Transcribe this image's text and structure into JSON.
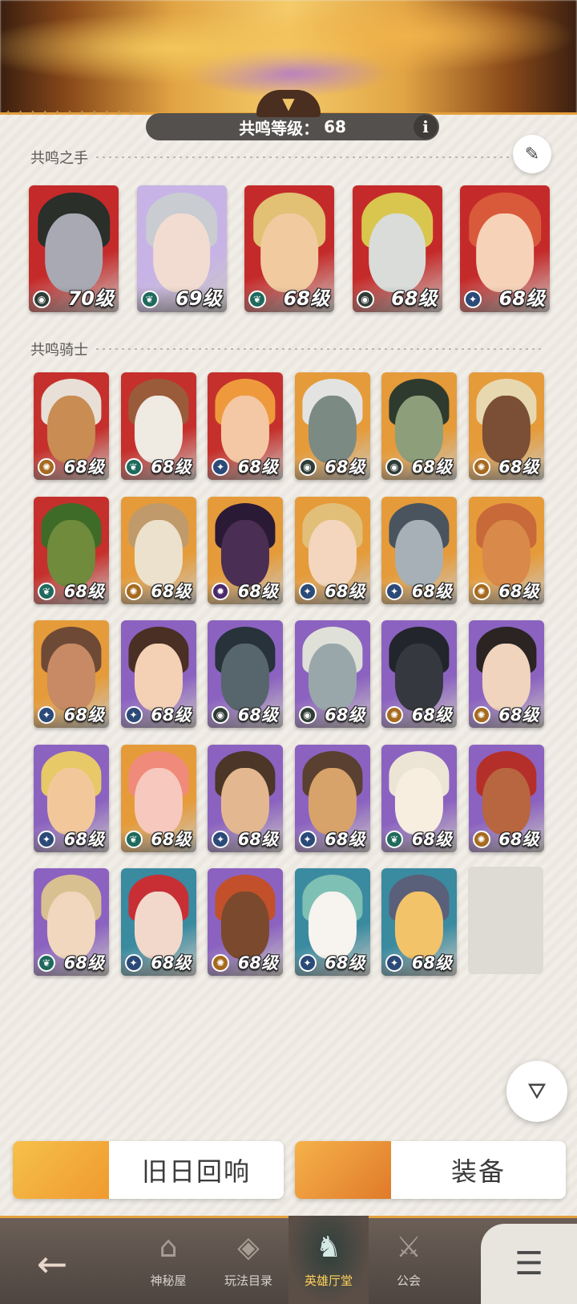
{
  "header": {
    "resonance_label": "共鸣等级：",
    "resonance_level": "68",
    "info_glyph": "i"
  },
  "sections": {
    "hands_title": "共鸣之手",
    "knights_title": "共鸣骑士"
  },
  "hands": [
    {
      "level": "70级",
      "faction": "mauler",
      "bg": "#c52a2a",
      "skin": "#a9a9b3",
      "hair": "#2a2f2a"
    },
    {
      "level": "69级",
      "faction": "wilder",
      "bg": "#c7b3e6",
      "skin": "#f2dcd2",
      "hair": "#c9ccd0"
    },
    {
      "level": "68级",
      "faction": "wilder",
      "bg": "#c52a2a",
      "skin": "#f1caa0",
      "hair": "#e2c074"
    },
    {
      "level": "68级",
      "faction": "mauler",
      "bg": "#c52a2a",
      "skin": "#d9dcd8",
      "hair": "#d9c64f"
    },
    {
      "level": "68级",
      "faction": "celestial",
      "bg": "#c52a2a",
      "skin": "#f6d2b9",
      "hair": "#d95a3a"
    }
  ],
  "knights": [
    {
      "level": "68级",
      "faction": "lightbearer",
      "bg": "#c5302c",
      "skin": "#c98c52",
      "hair": "#e8e0d6"
    },
    {
      "level": "68级",
      "faction": "wilder",
      "bg": "#c5302c",
      "skin": "#efeae2",
      "hair": "#9a5b3a"
    },
    {
      "level": "68级",
      "faction": "celestial",
      "bg": "#c5302c",
      "skin": "#f4c8a4",
      "hair": "#ee9a3c"
    },
    {
      "level": "68级",
      "faction": "mauler",
      "bg": "#e59b3a",
      "skin": "#7c8a84",
      "hair": "#e3e4e2"
    },
    {
      "level": "68级",
      "faction": "mauler",
      "bg": "#e59b3a",
      "skin": "#8d9e7a",
      "hair": "#2e3a2e"
    },
    {
      "level": "68级",
      "faction": "lightbearer",
      "bg": "#e59b3a",
      "skin": "#7a4f35",
      "hair": "#e8d8b0"
    },
    {
      "level": "68级",
      "faction": "wilder",
      "bg": "#c5302c",
      "skin": "#6f8b3b",
      "hair": "#3f6b28"
    },
    {
      "level": "68级",
      "faction": "lightbearer",
      "bg": "#e59b3a",
      "skin": "#ece1cc",
      "hair": "#c09a6a"
    },
    {
      "level": "68级",
      "faction": "hypogean",
      "bg": "#e59b3a",
      "skin": "#4b2e53",
      "hair": "#2b1a35"
    },
    {
      "level": "68级",
      "faction": "celestial",
      "bg": "#e59b3a",
      "skin": "#f3d6bd",
      "hair": "#e2bf79"
    },
    {
      "level": "68级",
      "faction": "celestial",
      "bg": "#e59b3a",
      "skin": "#a7b0b7",
      "hair": "#49545e"
    },
    {
      "level": "68级",
      "faction": "lightbearer",
      "bg": "#e59b3a",
      "skin": "#d98a4a",
      "hair": "#c8693a"
    },
    {
      "level": "68级",
      "faction": "celestial",
      "bg": "#e59b3a",
      "skin": "#c78a64",
      "hair": "#6e4a36"
    },
    {
      "level": "68级",
      "faction": "celestial",
      "bg": "#8b62c0",
      "skin": "#f4d1b5",
      "hair": "#4a2f24"
    },
    {
      "level": "68级",
      "faction": "mauler",
      "bg": "#8b62c0",
      "skin": "#56666c",
      "hair": "#27323a"
    },
    {
      "level": "68级",
      "faction": "mauler",
      "bg": "#8b62c0",
      "skin": "#9aa7aa",
      "hair": "#dfe0d8"
    },
    {
      "level": "68级",
      "faction": "lightbearer",
      "bg": "#8b62c0",
      "skin": "#35383f",
      "hair": "#22252b"
    },
    {
      "level": "68级",
      "faction": "lightbearer",
      "bg": "#8b62c0",
      "skin": "#f0d4bd",
      "hair": "#2b2423"
    },
    {
      "level": "68级",
      "faction": "celestial",
      "bg": "#8b62c0",
      "skin": "#f2c89b",
      "hair": "#e7c968"
    },
    {
      "level": "68级",
      "faction": "wilder",
      "bg": "#e59b3a",
      "skin": "#f7c8bd",
      "hair": "#f08a7a"
    },
    {
      "level": "68级",
      "faction": "celestial",
      "bg": "#8b62c0",
      "skin": "#e3b890",
      "hair": "#4b3628"
    },
    {
      "level": "68级",
      "faction": "celestial",
      "bg": "#8b62c0",
      "skin": "#d8a36a",
      "hair": "#5a4030"
    },
    {
      "level": "68级",
      "faction": "wilder",
      "bg": "#8b62c0",
      "skin": "#f7eee0",
      "hair": "#ece5d5"
    },
    {
      "level": "68级",
      "faction": "lightbearer",
      "bg": "#8b62c0",
      "skin": "#b8663f",
      "hair": "#b42f2a"
    },
    {
      "level": "68级",
      "faction": "wilder",
      "bg": "#8b62c0",
      "skin": "#f1d7bd",
      "hair": "#d9c090"
    },
    {
      "level": "68级",
      "faction": "celestial",
      "bg": "#3a8aa0",
      "skin": "#f2d8cb",
      "hair": "#c72f35"
    },
    {
      "level": "68级",
      "faction": "lightbearer",
      "bg": "#8b62c0",
      "skin": "#7b4a2e",
      "hair": "#c2502a"
    },
    {
      "level": "68级",
      "faction": "celestial",
      "bg": "#3a8aa0",
      "skin": "#f7f3ee",
      "hair": "#7fc0b4"
    },
    {
      "level": "68级",
      "faction": "celestial",
      "bg": "#3a8aa0",
      "skin": "#f3c36a",
      "hair": "#5a5f7a"
    }
  ],
  "factions": {
    "mauler": {
      "icon": "mauler-icon",
      "glyph": "◉",
      "color": "#2f3b35"
    },
    "wilder": {
      "icon": "wilder-icon",
      "glyph": "❦",
      "color": "#1f6a5d"
    },
    "celestial": {
      "icon": "celestial-icon",
      "glyph": "✦",
      "color": "#2b4a78"
    },
    "lightbearer": {
      "icon": "lightbearer-icon",
      "glyph": "✺",
      "color": "#a66a1f"
    },
    "hypogean": {
      "icon": "hypogean-icon",
      "glyph": "✹",
      "color": "#4a2a6a"
    }
  },
  "buttons": {
    "echoes_label": "旧日回响",
    "equipment_label": "装备"
  },
  "nav": {
    "back_icon": "back-arrow-icon",
    "items": [
      {
        "label": "神秘屋",
        "icon": "mystery-house-icon"
      },
      {
        "label": "玩法目录",
        "icon": "game-catalog-icon"
      },
      {
        "label": "英雄厅堂",
        "icon": "hero-hall-icon"
      },
      {
        "label": "公会",
        "icon": "guild-icon"
      }
    ],
    "active_index": 2,
    "menu_icon": "menu-list-icon"
  }
}
